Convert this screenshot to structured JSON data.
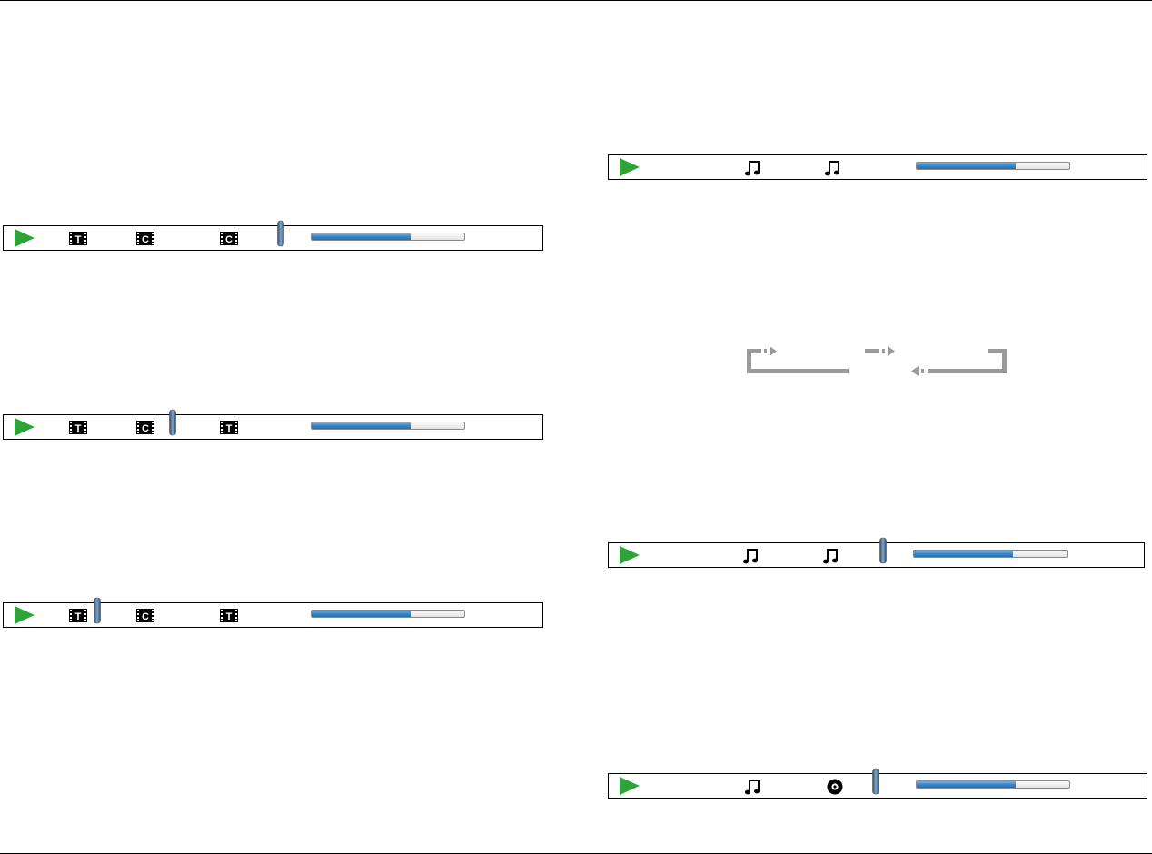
{
  "players": [
    {
      "id": "left-1",
      "kind": "video",
      "icons": [
        "film-T-icon",
        "film-C-icon",
        "film-C-icon"
      ],
      "marker_after_icon": 3,
      "progress": 0.65
    },
    {
      "id": "left-2",
      "kind": "video",
      "icons": [
        "film-T-icon",
        "film-C-icon",
        "film-T-icon"
      ],
      "marker_after_icon": 2,
      "progress": 0.65
    },
    {
      "id": "left-3",
      "kind": "video",
      "icons": [
        "film-T-icon",
        "film-C-icon",
        "film-T-icon"
      ],
      "marker_after_icon": 1,
      "progress": 0.65
    },
    {
      "id": "right-1",
      "kind": "audio",
      "icons": [
        "music-note-icon",
        "music-note-icon"
      ],
      "marker_after_icon": null,
      "progress": 0.65
    },
    {
      "id": "right-2",
      "kind": "audio",
      "icons": [
        "music-note-icon",
        "music-note-icon"
      ],
      "marker_after_icon": 2,
      "progress": 0.65
    },
    {
      "id": "right-3",
      "kind": "audio",
      "icons": [
        "music-note-icon",
        "disc-icon"
      ],
      "marker_after_icon": 2,
      "progress": 0.65
    }
  ],
  "film_letters": {
    "T": "T",
    "C": "C"
  },
  "colors": {
    "play": "#2fa33a",
    "progress_fill": "#3a86c6",
    "cycle_arrows": "#9a9a9a",
    "border": "#000000"
  }
}
